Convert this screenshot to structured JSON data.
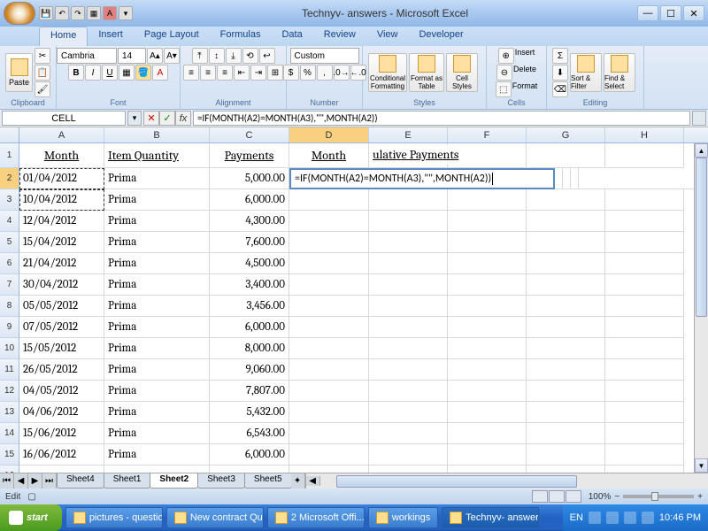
{
  "app": {
    "title": "Technyv- answers - Microsoft Excel"
  },
  "ribbon": {
    "tabs": [
      "Home",
      "Insert",
      "Page Layout",
      "Formulas",
      "Data",
      "Review",
      "View",
      "Developer"
    ],
    "active_tab": "Home",
    "font_name": "Cambria",
    "font_size": "14",
    "number_format": "Custom",
    "groups": {
      "clipboard": "Clipboard",
      "font": "Font",
      "alignment": "Alignment",
      "number": "Number",
      "styles": "Styles",
      "cells": "Cells",
      "editing": "Editing"
    },
    "paste": "Paste",
    "conditional": "Conditional Formatting",
    "format_table": "Format as Table",
    "cell_styles": "Cell Styles",
    "insert": "Insert",
    "delete": "Delete",
    "format": "Format",
    "sort_filter": "Sort & Filter",
    "find_select": "Find & Select"
  },
  "formula_bar": {
    "name_box": "CELL",
    "formula": "=IF(MONTH(A2)=MONTH(A3),\"\",MONTH(A2))"
  },
  "columns": [
    "A",
    "B",
    "C",
    "D",
    "E",
    "F",
    "G",
    "H"
  ],
  "header_row": {
    "A": "Month",
    "B": "Item Quantity",
    "C": "Payments",
    "D": "Month",
    "E_overflow": "ulative Payments"
  },
  "editing_cell": {
    "text": "=IF(MONTH(A2)=MONTH(A3),\"\",MONTH(A2))"
  },
  "data_rows": [
    {
      "date": "01/04/2012",
      "item": "Prima",
      "pay": "5,000.00"
    },
    {
      "date": "10/04/2012",
      "item": "Prima",
      "pay": "6,000.00"
    },
    {
      "date": "12/04/2012",
      "item": "Prima",
      "pay": "4,300.00"
    },
    {
      "date": "15/04/2012",
      "item": "Prima",
      "pay": "7,600.00"
    },
    {
      "date": "21/04/2012",
      "item": "Prima",
      "pay": "4,500.00"
    },
    {
      "date": "30/04/2012",
      "item": "Prima",
      "pay": "3,400.00"
    },
    {
      "date": "05/05/2012",
      "item": "Prima",
      "pay": "3,456.00"
    },
    {
      "date": "07/05/2012",
      "item": "Prima",
      "pay": "6,000.00"
    },
    {
      "date": "15/05/2012",
      "item": "Prima",
      "pay": "8,000.00"
    },
    {
      "date": "26/05/2012",
      "item": "Prima",
      "pay": "9,060.00"
    },
    {
      "date": "04/05/2012",
      "item": "Prima",
      "pay": "7,807.00"
    },
    {
      "date": "04/06/2012",
      "item": "Prima",
      "pay": "5,432.00"
    },
    {
      "date": "15/06/2012",
      "item": "Prima",
      "pay": "6,543.00"
    },
    {
      "date": "16/06/2012",
      "item": "Prima",
      "pay": "6,000.00"
    }
  ],
  "sheets": {
    "tabs": [
      "Sheet4",
      "Sheet1",
      "Sheet2",
      "Sheet3",
      "Sheet5"
    ],
    "active": "Sheet2"
  },
  "status": {
    "mode": "Edit",
    "zoom": "100%"
  },
  "taskbar": {
    "start": "start",
    "buttons": [
      "pictures - questions",
      "New contract Qu...",
      "2 Microsoft Offi...",
      "workings",
      "Technyv- answers..."
    ],
    "lang": "EN",
    "time": "10:46 PM"
  }
}
